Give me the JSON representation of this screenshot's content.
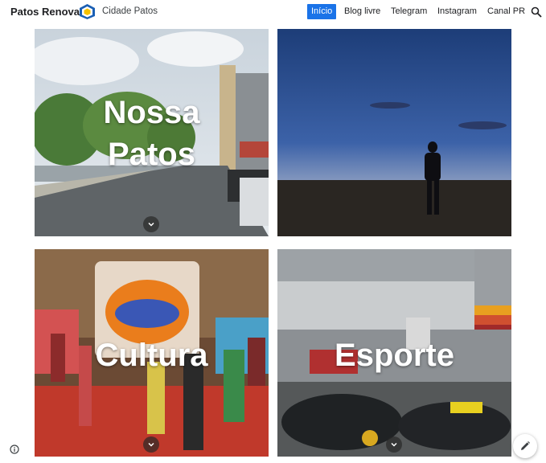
{
  "header": {
    "site_name": "Patos Renovada",
    "subtitle": "Cidade Patos",
    "nav": [
      {
        "label": "Início",
        "active": true
      },
      {
        "label": "Blog livre",
        "active": false
      },
      {
        "label": "Telegram",
        "active": false
      },
      {
        "label": "Instagram",
        "active": false
      },
      {
        "label": "Canal PR",
        "active": false
      }
    ],
    "search_icon": "search-icon"
  },
  "tiles": [
    {
      "title_line1": "Nossa",
      "title_line2": "Patos",
      "image": "city-street-photo"
    },
    {
      "title": "",
      "image": "sunset-silhouette-photo"
    },
    {
      "title": "Cultura",
      "image": "arraial-festival-photo"
    },
    {
      "title": "Esporte",
      "image": "kart-track-photo"
    }
  ],
  "footer": {
    "info_icon": "info-icon",
    "edit_icon": "pencil-icon"
  },
  "colors": {
    "accent": "#1a73e8"
  }
}
